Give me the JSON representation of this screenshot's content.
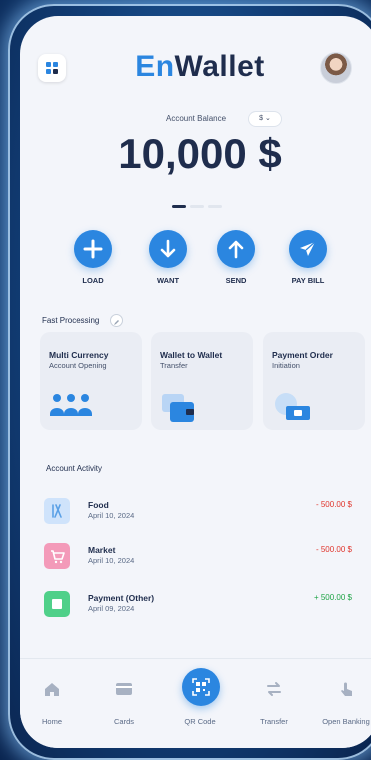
{
  "header": {
    "logo_part1": "En",
    "logo_part2": "Wallet",
    "menu_icon": "apps-icon",
    "avatar_icon": "user-avatar"
  },
  "balance": {
    "label": "Account Balance",
    "currency": "$",
    "amount": "10,000 $",
    "carousel_pages": 3,
    "carousel_active": 1
  },
  "actions": [
    {
      "label": "LOAD",
      "icon": "plus-icon"
    },
    {
      "label": "WANT",
      "icon": "arrow-down-icon"
    },
    {
      "label": "SEND",
      "icon": "arrow-up-icon"
    },
    {
      "label": "PAY BILL",
      "icon": "paper-plane-icon"
    }
  ],
  "fast_processing": {
    "title": "Fast Processing",
    "cards": [
      {
        "title": "Multi Currency",
        "subtitle": "Account Opening"
      },
      {
        "title": "Wallet to Wallet",
        "subtitle": "Transfer"
      },
      {
        "title": "Payment Order",
        "subtitle": "Initiation"
      }
    ]
  },
  "activity": {
    "title": "Account Activity",
    "items": [
      {
        "name": "Food",
        "date": "April 10, 2024",
        "amount": "- 500.00 $",
        "type": "debit",
        "color": "#cfe3fb",
        "icon": "utensils-icon"
      },
      {
        "name": "Market",
        "date": "April 10, 2024",
        "amount": "- 500.00 $",
        "type": "debit",
        "color": "#f39ab9",
        "icon": "shopping-cart-icon"
      },
      {
        "name": "Payment (Other)",
        "date": "April 09, 2024",
        "amount": "+ 500.00 $",
        "type": "credit",
        "color": "#4fd089",
        "icon": "payment-icon"
      }
    ]
  },
  "nav": [
    {
      "label": "Home",
      "icon": "home-icon"
    },
    {
      "label": "Cards",
      "icon": "card-icon"
    },
    {
      "label": "QR Code",
      "icon": "qr-code-icon"
    },
    {
      "label": "Transfer",
      "icon": "transfer-icon"
    },
    {
      "label": "Open Banking",
      "icon": "touch-icon"
    }
  ],
  "colors": {
    "accent": "#2b86e0",
    "text": "#1f2d4d",
    "negative": "#e0352c",
    "positive": "#1fa446"
  }
}
